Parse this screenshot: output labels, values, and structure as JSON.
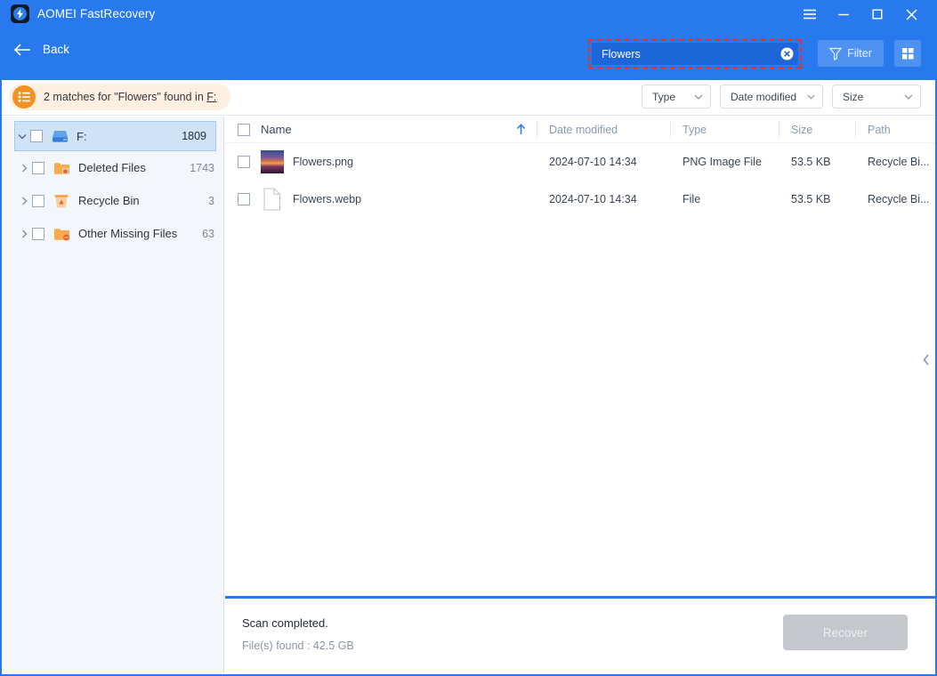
{
  "window": {
    "app_title": "AOMEI FastRecovery",
    "logo_icon": "lightning-bolt-icon",
    "controls": {
      "menu": "hamburger-menu-icon",
      "minimize": "minimize-icon",
      "maximize": "maximize-icon",
      "close": "close-icon"
    },
    "accent_color": "#2979ee"
  },
  "toolbar": {
    "back_label": "Back",
    "back_icon": "arrow-left-icon",
    "search": {
      "value": "Flowers",
      "placeholder": "Search",
      "clear_icon": "clear-circle-icon",
      "highlight_color": "#ee2d24"
    },
    "filter_label": "Filter",
    "filter_icon": "funnel-icon",
    "grid_view_icon": "grid-view-icon"
  },
  "banner": {
    "icon": "list-badge-icon",
    "prefix": "2 matches for \"Flowers\"  found in ",
    "location": "F:",
    "bg_color": "#fdf0e0",
    "icon_color": "#f59123"
  },
  "filters": [
    {
      "label": "Type"
    },
    {
      "label": "Date modified"
    },
    {
      "label": "Size"
    }
  ],
  "sidebar": {
    "items": [
      {
        "label": "F:",
        "count": "1809",
        "icon": "hard-drive-icon",
        "level": 0,
        "selected": true,
        "expanded": true
      },
      {
        "label": "Deleted Files",
        "count": "1743",
        "icon": "deleted-folder-icon",
        "level": 1,
        "selected": false,
        "expanded": false
      },
      {
        "label": "Recycle Bin",
        "count": "3",
        "icon": "recycle-bin-icon",
        "level": 1,
        "selected": false,
        "expanded": false
      },
      {
        "label": "Other Missing Files",
        "count": "63",
        "icon": "missing-folder-icon",
        "level": 1,
        "selected": false,
        "expanded": false
      }
    ]
  },
  "table": {
    "columns": {
      "name": "Name",
      "date_modified": "Date modified",
      "type": "Type",
      "size": "Size",
      "path": "Path"
    },
    "sort": {
      "column": "Name",
      "direction": "ascending",
      "icon": "arrow-up-icon"
    },
    "rows": [
      {
        "name": "Flowers.png",
        "date_modified": "2024-07-10 14:34",
        "type": "PNG Image File",
        "size": "53.5 KB",
        "path": "Recycle Bi...",
        "thumbnail": "image-thumbnail"
      },
      {
        "name": "Flowers.webp",
        "date_modified": "2024-07-10 14:34",
        "type": "File",
        "size": "53.5 KB",
        "path": "Recycle Bi...",
        "thumbnail": "generic-file-icon"
      }
    ]
  },
  "panel_toggle_icon": "chevron-left-icon",
  "footer": {
    "status": "Scan completed.",
    "detail": "File(s) found : 42.5 GB",
    "recover_label": "Recover"
  }
}
